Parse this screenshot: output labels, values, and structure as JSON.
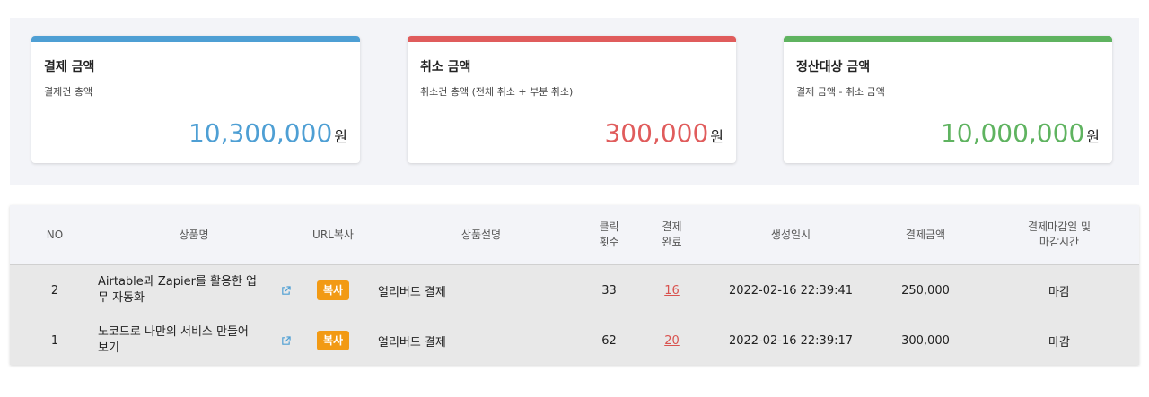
{
  "cards": [
    {
      "title": "결제 금액",
      "subtitle": "결제건 총액",
      "amount": "10,300,000",
      "unit": "원",
      "color": "#4e9fd4"
    },
    {
      "title": "취소 금액",
      "subtitle": "취소건 총액 (전체 취소 + 부분 취소)",
      "amount": "300,000",
      "unit": "원",
      "color": "#e05c5c"
    },
    {
      "title": "정산대상 금액",
      "subtitle": "결제 금액 - 취소 금액",
      "amount": "10,000,000",
      "unit": "원",
      "color": "#5fb360"
    }
  ],
  "table": {
    "headers": {
      "no": "NO",
      "product": "상품명",
      "url_copy": "URL복사",
      "description": "상품설명",
      "clicks_l1": "클릭",
      "clicks_l2": "횟수",
      "paid_l1": "결제",
      "paid_l2": "완료",
      "created": "생성일시",
      "amount": "결제금액",
      "deadline_l1": "결제마감일 및",
      "deadline_l2": "마감시간"
    },
    "rows": [
      {
        "no": "2",
        "name_l1": "Airtable과 Zapier를 활용한 업",
        "name_l2": "무 자동화",
        "copy": "복사",
        "description": "얼리버드 결제",
        "clicks": "33",
        "paid": "16",
        "created": "2022-02-16 22:39:41",
        "amount": "250,000",
        "status": "마감"
      },
      {
        "no": "1",
        "name_l1": "노코드로 나만의 서비스 만들어",
        "name_l2": "보기",
        "copy": "복사",
        "description": "얼리버드 결제",
        "clicks": "62",
        "paid": "20",
        "created": "2022-02-16 22:39:17",
        "amount": "300,000",
        "status": "마감"
      }
    ]
  },
  "icons": {
    "external_link": "external-link-icon"
  },
  "colors": {
    "copy_button": "#f29a14",
    "link": "#d9534f",
    "external_icon": "#4e9fd4"
  }
}
